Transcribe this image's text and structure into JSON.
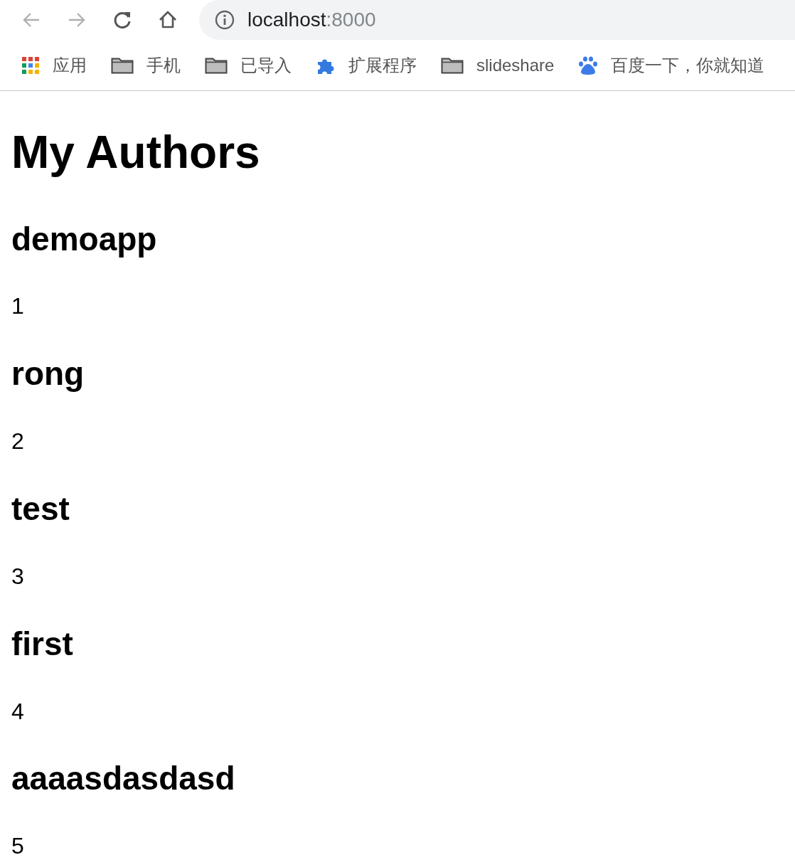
{
  "toolbar": {
    "nav_buttons": [
      {
        "kind": "back",
        "disabled": true
      },
      {
        "kind": "forward",
        "disabled": true
      },
      {
        "kind": "reload",
        "disabled": false
      },
      {
        "kind": "home",
        "disabled": false
      }
    ],
    "address": {
      "host": "localhost",
      "port": ":8000"
    }
  },
  "bookmarks": [
    {
      "kind": "apps",
      "label": "应用"
    },
    {
      "kind": "folder",
      "label": "手机"
    },
    {
      "kind": "folder",
      "label": "已导入"
    },
    {
      "kind": "extension",
      "label": "扩展程序"
    },
    {
      "kind": "folder",
      "label": "slideshare"
    },
    {
      "kind": "site",
      "label": "百度一下，你就知道"
    }
  ],
  "page": {
    "title": "My Authors",
    "authors": [
      {
        "name": "demoapp",
        "id": "1"
      },
      {
        "name": "rong",
        "id": "2"
      },
      {
        "name": "test",
        "id": "3"
      },
      {
        "name": "first",
        "id": "4"
      },
      {
        "name": "aaaasdasdasd",
        "id": "5"
      }
    ]
  }
}
